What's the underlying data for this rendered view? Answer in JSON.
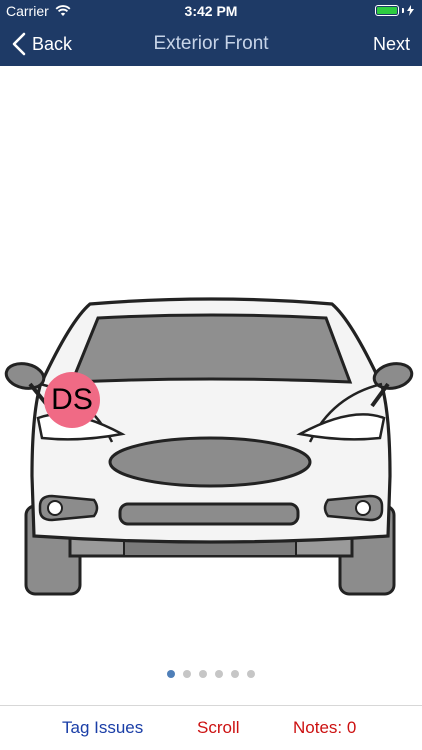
{
  "status": {
    "carrier": "Carrier",
    "time": "3:42 PM"
  },
  "nav": {
    "back_label": "Back",
    "title": "Exterior Front",
    "next_label": "Next"
  },
  "tag": {
    "label": "DS"
  },
  "pager": {
    "count": 6,
    "active": 0
  },
  "toolbar": {
    "tag_issues": "Tag Issues",
    "scroll": "Scroll",
    "notes": "Notes: 0"
  },
  "colors": {
    "nav_bar": "#1e3a66",
    "tag_fill": "#f06a85",
    "link_blue": "#1a3ea7",
    "alert_red": "#cc1111",
    "active_dot": "#4f7fb8"
  }
}
